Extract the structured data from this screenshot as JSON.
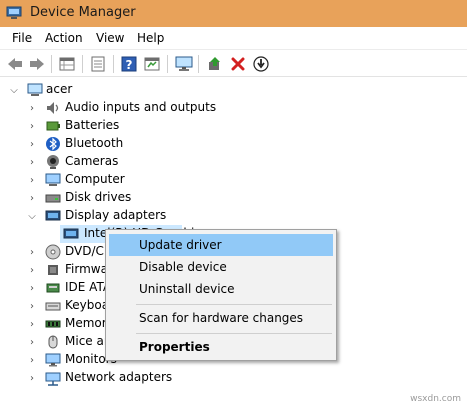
{
  "window": {
    "title": "Device Manager",
    "icon": "device-manager-icon"
  },
  "menu": [
    "File",
    "Action",
    "View",
    "Help"
  ],
  "toolbar": {
    "icons": [
      "back-arrow-icon",
      "forward-arrow-icon",
      "properties-grid-icon",
      "show-hidden-icon",
      "help-icon",
      "action-panel-icon",
      "monitor-icon",
      "update-driver-icon",
      "uninstall-x-icon",
      "download-icon"
    ]
  },
  "tree": {
    "root": "acer",
    "items": [
      {
        "label": "Audio inputs and outputs",
        "icon": "speaker-icon",
        "expanded": false
      },
      {
        "label": "Batteries",
        "icon": "battery-icon",
        "expanded": false
      },
      {
        "label": "Bluetooth",
        "icon": "bluetooth-icon",
        "expanded": false
      },
      {
        "label": "Cameras",
        "icon": "camera-icon",
        "expanded": false
      },
      {
        "label": "Computer",
        "icon": "computer-icon",
        "expanded": false
      },
      {
        "label": "Disk drives",
        "icon": "disk-drive-icon",
        "expanded": false
      },
      {
        "label": "Display adapters",
        "icon": "display-adapter-icon",
        "expanded": true
      },
      {
        "label": "DVD/CD-ROM drives",
        "icon": "dvd-drive-icon",
        "expanded": false
      },
      {
        "label": "Firmware",
        "icon": "firmware-icon",
        "expanded": false
      },
      {
        "label": "IDE ATA/ATAPI controllers",
        "icon": "ide-controller-icon",
        "expanded": false
      },
      {
        "label": "Keyboards",
        "icon": "keyboard-icon",
        "expanded": false
      },
      {
        "label": "Memory technology devices",
        "icon": "memory-icon",
        "expanded": false
      },
      {
        "label": "Mice and other pointing devices",
        "icon": "mouse-icon",
        "expanded": false
      },
      {
        "label": "Monitors",
        "icon": "monitor-icon",
        "expanded": false
      },
      {
        "label": "Network adapters",
        "icon": "network-adapter-icon",
        "expanded": false
      }
    ],
    "child": {
      "label": "Intel(R) HD Graphics",
      "icon": "display-adapter-icon"
    }
  },
  "context_menu": {
    "items": [
      "Update driver",
      "Disable device",
      "Uninstall device",
      "Scan for hardware changes",
      "Properties"
    ],
    "highlighted": "Update driver",
    "default": "Properties"
  },
  "watermark": "wsxdn.com",
  "colors": {
    "titlebar": "#e8a25a",
    "selection": "#cce8ff",
    "menu_highlight": "#91c9f7",
    "menu_bg": "#f2f2f2"
  }
}
